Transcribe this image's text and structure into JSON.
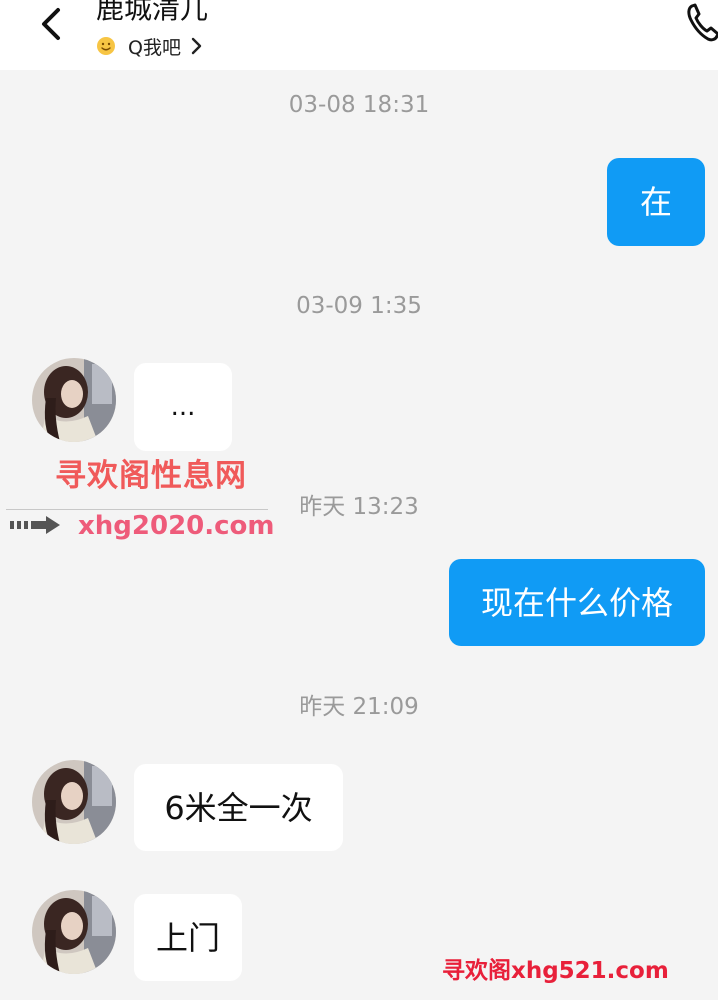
{
  "header": {
    "contact_name": "鹿城清儿",
    "status_text": "Q我吧",
    "back_icon": "chevron-left-icon",
    "call_icon": "phone-icon",
    "status_emoji": "smiley-face-icon"
  },
  "colors": {
    "outgoing_bubble": "#109bf5",
    "incoming_bubble": "#ffffff",
    "background": "#f4f4f4",
    "timestamp_text": "#9a9a9a"
  },
  "messages": [
    {
      "type": "timestamp",
      "text": "03-08 18:31"
    },
    {
      "type": "outgoing",
      "text": "在"
    },
    {
      "type": "timestamp",
      "text": "03-09 1:35"
    },
    {
      "type": "incoming",
      "text": "..."
    },
    {
      "type": "timestamp",
      "text": "昨天 13:23"
    },
    {
      "type": "outgoing",
      "text": "现在什么价格"
    },
    {
      "type": "timestamp",
      "text": "昨天 21:09"
    },
    {
      "type": "incoming",
      "text": "6米全一次"
    },
    {
      "type": "incoming",
      "text": "上门"
    }
  ],
  "watermarks": {
    "title": "寻欢阁性息网",
    "site_url": "xhg2020.com",
    "footer": "寻欢阁xhg521.com"
  }
}
